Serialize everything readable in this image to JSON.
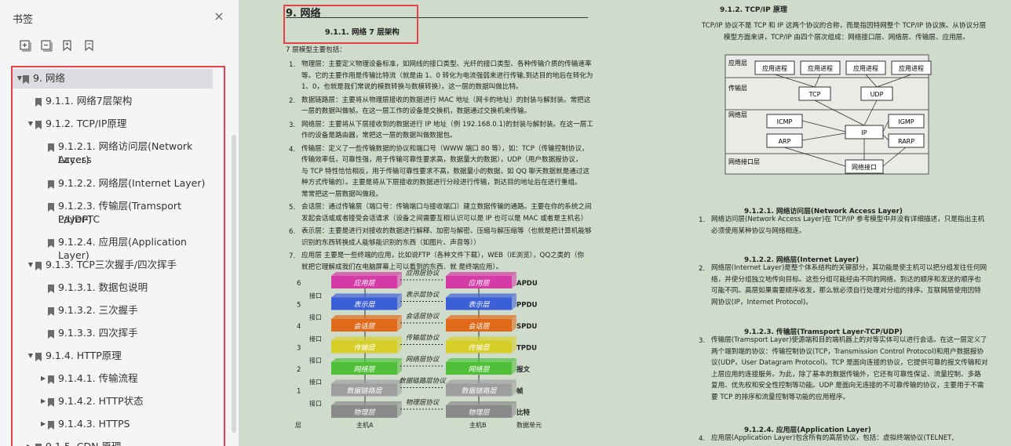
{
  "sidebar": {
    "title": "书签",
    "close": "×",
    "toolbar": [
      "expand-all-icon",
      "collapse-all-icon",
      "add-bookmark-icon",
      "bookmark-icon"
    ],
    "items": [
      {
        "label": "9. 网络",
        "level": 0,
        "arrow": "▲",
        "selected": true
      },
      {
        "label": "9.1.1. 网络7层架构",
        "level": 1,
        "arrow": ""
      },
      {
        "label": "9.1.2. TCP/IP原理",
        "level": 1,
        "arrow": "▲"
      },
      {
        "label": "9.1.2.1. 网络访问层(Network Access Layer)",
        "level": 2,
        "arrow": "",
        "lines": [
          "9.1.2.1. 网络访问层(Network Access",
          "Layer)"
        ]
      },
      {
        "label": "9.1.2.2. 网络层(Internet Layer)",
        "level": 2,
        "arrow": ""
      },
      {
        "label": "9.1.2.3. 传输层(Tramsport Layer-TCP/UDP)",
        "level": 2,
        "arrow": "",
        "lines": [
          "9.1.2.3. 传输层(Tramsport Layer-TC",
          "P/UDP)"
        ]
      },
      {
        "label": "9.1.2.4. 应用层(Application Layer)",
        "level": 2,
        "arrow": ""
      },
      {
        "label": "9.1.3. TCP三次握手/四次挥手",
        "level": 1,
        "arrow": "▲"
      },
      {
        "label": "9.1.3.1. 数据包说明",
        "level": 2,
        "arrow": ""
      },
      {
        "label": "9.1.3.2. 三次握手",
        "level": 2,
        "arrow": ""
      },
      {
        "label": "9.1.3.3. 四次挥手",
        "level": 2,
        "arrow": ""
      },
      {
        "label": "9.1.4. HTTP原理",
        "level": 1,
        "arrow": "▲"
      },
      {
        "label": "9.1.4.1. 传输流程",
        "level": 2,
        "arrow": "▶"
      },
      {
        "label": "9.1.4.2. HTTP状态",
        "level": 2,
        "arrow": "▶"
      },
      {
        "label": "9.1.4.3. HTTPS",
        "level": 2,
        "arrow": "▶"
      },
      {
        "label": "9.1.5. CDN 原理",
        "level": 1,
        "arrow": "▶"
      }
    ]
  },
  "page1": {
    "chapter": "9. 网络",
    "section": "9.1.1.  网络 7 层架构",
    "intro": "7 层模型主要包括：",
    "items": [
      {
        "n": "1.",
        "lines": [
          "物理层：主要定义物理设备标准，如网线的接口类型、光纤的接口类型、各种传输介质的传输速率",
          "等。它的主要作用是传输比特流（就是由 1、0 转化为电流强弱来进行传输,到达目的地后在转化为",
          "1、0，也就是我们常说的模数转换与数模转换）。这一层的数据叫做比特。"
        ]
      },
      {
        "n": "2.",
        "lines": [
          "数据链路层：主要将从物理层接收的数据进行 MAC 地址（网卡的地址）的封装与解封装。常把这",
          "一层的数据叫做帧。在这一层工作的设备是交换机，数据通过交换机来传输。"
        ]
      },
      {
        "n": "3.",
        "lines": [
          "网络层：主要将从下层接收到的数据进行 IP 地址（例 192.168.0.1)的封装与解封装。在这一层工",
          "作的设备是路由器，常把这一层的数据叫做数据包。"
        ]
      },
      {
        "n": "4.",
        "lines": [
          "传输层：定义了一些传输数据的协议和端口号（WWW 端口 80 等），如：TCP（传输控制协议，",
          "传输效率低，可靠性强，用于传输可靠性要求高，数据量大的数据），UDP（用户数据报协议，",
          "与 TCP 特性恰恰相反，用于传输可靠性要求不高，数据量小的数据，如 QQ 聊天数据就是通过这",
          "种方式传输的）。主要是将从下层接收的数据进行分段进行传输，到达目的地址后在进行重组。",
          "常常把这一层数据叫做段。"
        ]
      },
      {
        "n": "5.",
        "lines": [
          "会话层：通过传输层（端口号：传输端口与接收端口）建立数据传输的通路。主要在你的系统之间",
          "发起会话或或者接受会话请求（设备之间需要互相认识可以是 IP 也可以是 MAC 或者是主机名）"
        ]
      },
      {
        "n": "6.",
        "lines": [
          "表示层：主要是进行对接收的数据进行解释、加密与解密、压缩与解压缩等（也就是把计算机能够",
          "识别的东西转换成人能够能识别的东西（如图片、声音等））"
        ]
      },
      {
        "n": "7.",
        "lines": [
          "应用层 主要是一些终端的应用，比如说FTP（各种文件下载），WEB（IE浏览），QQ之类的（你",
          "就把它理解成我们在电脑屏幕上可以看到的东西．就 是终端应用）。"
        ]
      }
    ],
    "diagram": {
      "layers": [
        "应用层",
        "表示层",
        "会话层",
        "传输层",
        "网络层",
        "数据链路层",
        "物理层"
      ],
      "layer_colors": [
        "#d63aa7",
        "#3a5fd6",
        "#e06a1a",
        "#d6cf2a",
        "#4fbf3a",
        "#9e9e9e",
        "#8a8a8a"
      ],
      "protocols": [
        "应用层协议",
        "表示层协议",
        "会话层协议",
        "传输层协议",
        "网络层协议",
        "数据链路层协议",
        "物理层协议"
      ],
      "layer_numbers": [
        "6",
        "5",
        "4",
        "3",
        "2",
        "1"
      ],
      "interface": "接口",
      "units": [
        "APDU",
        "PPDU",
        "SPDU",
        "TPDU",
        "报文",
        "帧",
        "比特"
      ],
      "bottom": [
        "层",
        "主机A",
        "主机B",
        "数据单元"
      ]
    }
  },
  "page2": {
    "heading_tcpip": "9.1.2.  TCP/IP 原理",
    "tcpip_lines": [
      "TCP/IP 协议不是 TCP 和 IP 这两个协议的合称，而是指因特网整个 TCP/IP 协议族。从协议分层",
      "模型方面来讲，TCP/IP 由四个层次组成：网络接口层、网络层、传输层、应用层。"
    ],
    "diagram": {
      "layers": [
        "应用层",
        "传输层",
        "网络层",
        "网络接口层"
      ],
      "apps": [
        "应用进程",
        "应用进程",
        "应用进程",
        "应用进程"
      ],
      "transport": [
        "TCP",
        "UDP"
      ],
      "network": [
        "ICMP",
        "IP",
        "IGMP",
        "ARP",
        "RARP"
      ],
      "iface": "网络接口"
    },
    "h1": "9.1.2.1.     网络访问层(Network Access Layer)",
    "s1": {
      "n": "1.",
      "lines": [
        "网络访问层(Network Access Layer)在 TCP/IP 参考模型中并没有详细描述，只是指出主机",
        "必须使用某种协议与网络相连。"
      ]
    },
    "h2": "9.1.2.2.     网络层(Internet Layer)",
    "s2": {
      "n": "2.",
      "lines": [
        "网络层(Internet Layer)是整个体系结构的关键部分，其功能是使主机可以把分组发往任何网",
        "络，并使分组独立地传向目标。这些分组可能经由不同的网络，到达的顺序和发送的顺序也",
        "可能不同。高层如果需要顺序收发，那么就必须自行处理对分组的排序。互联网层使用因特",
        "网协议(IP，Internet Protocol)。"
      ]
    },
    "h3": "9.1.2.3.     传输层(Tramsport Layer-TCP/UDP)",
    "s3": {
      "n": "3.",
      "lines": [
        "传输层(Tramsport Layer)使源端和目的端机器上的对等实体可以进行会话。在这一层定义了",
        "两个端到端的协议：传输控制协议(TCP，Transmission Control Protocol)和用户数据报协",
        "议(UDP，User Datagram Protocol)。TCP 是面向连接的协议，它提供可靠的报文传输和对",
        "上层应用的连接服务。为此，除了基本的数据传输外，它还有可靠性保证、流量控制、多路",
        "复用、优先权和安全性控制等功能。UDP 是面向无连接的不可靠传输的协议，主要用于不需",
        "要 TCP 的排序和流量控制等功能的应用程序。"
      ]
    },
    "h4": "9.1.2.4.     应用层(Application Layer)",
    "s4": {
      "n": "4.",
      "lines": [
        "应用层(Application Layer)包含所有的高层协议，包括：虚拟终端协议(TELNET,"
      ]
    }
  }
}
